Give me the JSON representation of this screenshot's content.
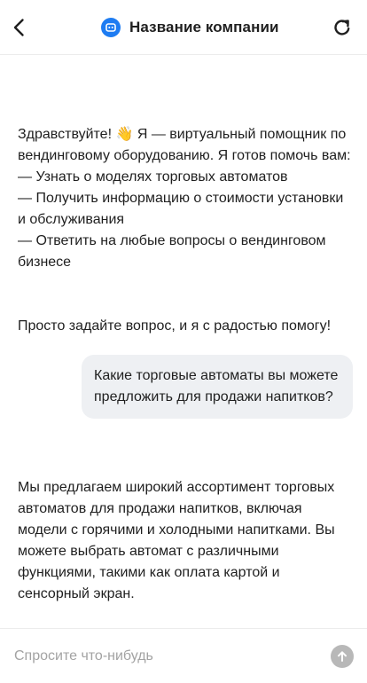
{
  "header": {
    "title": "Название компании",
    "back_icon": "chevron-left-icon",
    "brand_icon": "chat-bot-icon",
    "refresh_icon": "refresh-icon",
    "brand_color": "#1e7cf2"
  },
  "messages": [
    {
      "role": "bot",
      "paragraphs": [
        "Здравствуйте! 👋 Я — виртуальный помощник по вендинговому оборудованию. Я готов помочь вам:\n— Узнать о моделях торговых автоматов\n— Получить информацию о стоимости установки и обслуживания\n— Ответить на любые вопросы о вендинговом бизнесе",
        "Просто задайте вопрос, и я с радостью помогу!"
      ]
    },
    {
      "role": "user",
      "text": "Какие торговые автоматы вы можете предложить для продажи напитков?"
    },
    {
      "role": "bot",
      "paragraphs": [
        "Мы предлагаем широкий ассортимент торговых автоматов для продажи напитков, включая модели с горячими и холодными напитками. Вы можете выбрать автомат с различными функциями, такими как оплата картой и сенсорный экран."
      ]
    }
  ],
  "composer": {
    "placeholder": "Спросите что-нибудь",
    "value": "",
    "send_icon": "arrow-up-icon"
  }
}
